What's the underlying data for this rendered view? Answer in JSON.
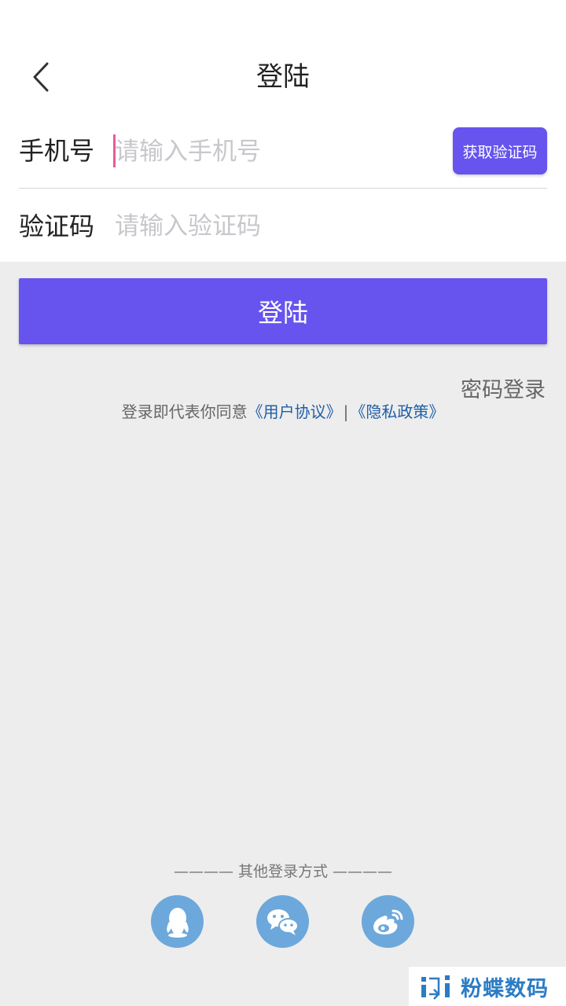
{
  "header": {
    "title": "登陆"
  },
  "form": {
    "phone_label": "手机号",
    "phone_placeholder": "请输入手机号",
    "phone_value": "",
    "get_code_label": "获取验证码",
    "code_label": "验证码",
    "code_placeholder": "请输入验证码",
    "code_value": ""
  },
  "actions": {
    "login_label": "登陆",
    "password_login_label": "密码登录"
  },
  "agreement": {
    "prefix": "登录即代表你同意",
    "user_agreement": "《用户协议》",
    "separator": "|",
    "privacy_policy": "《隐私政策》"
  },
  "other_login": {
    "title": "———— 其他登录方式 ————",
    "providers": [
      {
        "name": "qq",
        "icon": "qq-icon"
      },
      {
        "name": "wechat",
        "icon": "wechat-icon"
      },
      {
        "name": "weibo",
        "icon": "weibo-icon"
      }
    ]
  },
  "watermark": {
    "text": "粉蝶数码"
  },
  "colors": {
    "accent": "#6754ee",
    "social": "#6ca8db",
    "link": "#1f5fa6",
    "background": "#ededed"
  }
}
